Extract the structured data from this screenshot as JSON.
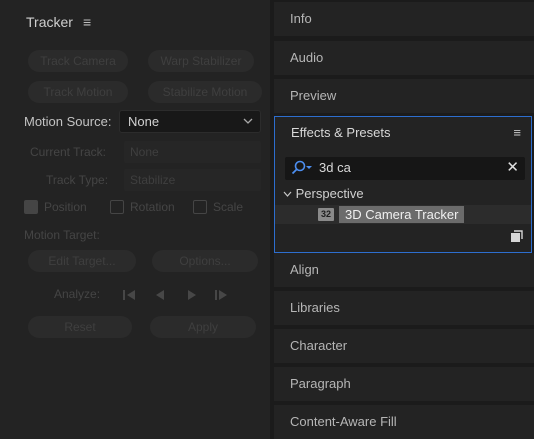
{
  "tracker": {
    "title": "Tracker",
    "menu_glyph": "≡",
    "buttons": {
      "track_camera": "Track Camera",
      "warp_stabilizer": "Warp Stabilizer",
      "track_motion": "Track Motion",
      "stabilize_motion": "Stabilize Motion"
    },
    "motion_source_label": "Motion Source:",
    "motion_source_value": "None",
    "current_track_label": "Current Track:",
    "current_track_value": "None",
    "track_type_label": "Track Type:",
    "track_type_value": "Stabilize",
    "checks": {
      "position": "Position",
      "rotation": "Rotation",
      "scale": "Scale"
    },
    "motion_target_label": "Motion Target:",
    "edit_target": "Edit Target...",
    "options": "Options...",
    "analyze_label": "Analyze:",
    "reset": "Reset",
    "apply": "Apply"
  },
  "panels": {
    "info": "Info",
    "audio": "Audio",
    "preview": "Preview",
    "align": "Align",
    "libraries": "Libraries",
    "character": "Character",
    "paragraph": "Paragraph",
    "content_aware_fill": "Content-Aware Fill"
  },
  "effects": {
    "title": "Effects & Presets",
    "menu_glyph": "≡",
    "search_value": "3d ca",
    "clear_glyph": "✕",
    "group": "Perspective",
    "item_badge": "32",
    "item_label": "3D Camera Tracker"
  },
  "colors": {
    "accent_border": "#2d6ecf",
    "search_icon": "#4c8ef0"
  }
}
